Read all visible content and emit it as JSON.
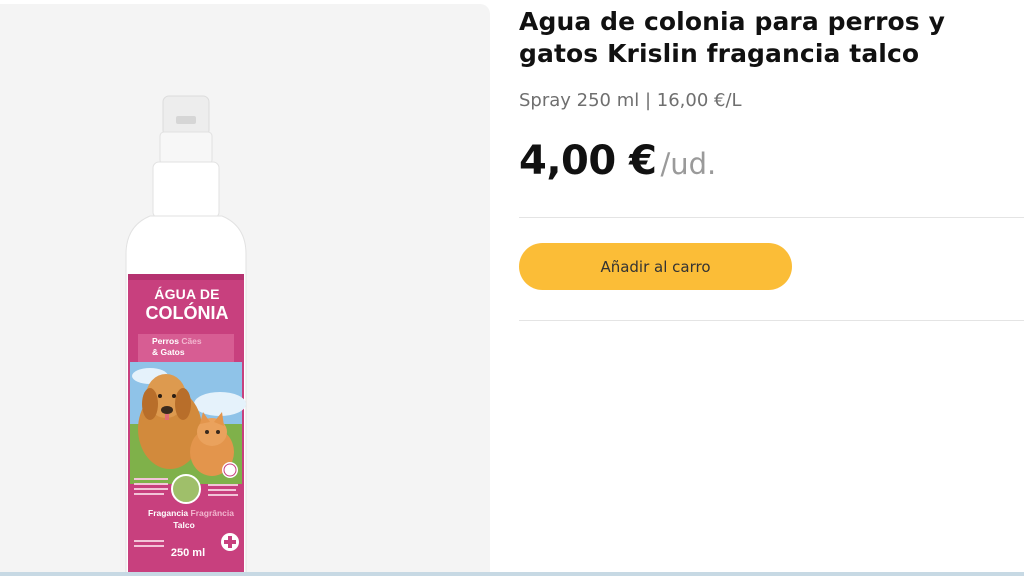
{
  "product": {
    "title": "Agua de colonia para perros y gatos Krislin fragancia talco",
    "meta": "Spray 250 ml | 16,00 €/L",
    "price": "4,00 €",
    "price_unit": "/ud.",
    "add_to_cart_label": "Añadir al carro"
  },
  "image_label": {
    "line1": "ÁGUA DE",
    "line2": "COLÓNIA",
    "species_a": "Perros",
    "species_b": "Cães",
    "species_c": "& Gatos",
    "fragrance_a": "Fragancia",
    "fragrance_b": "Fragrância",
    "fragrance_c": "Talco",
    "volume": "250 ml"
  },
  "colors": {
    "accent_button": "#fbbd37",
    "label_magenta": "#c8407e",
    "price_text": "#111111",
    "muted_text": "#6f6f6f"
  }
}
